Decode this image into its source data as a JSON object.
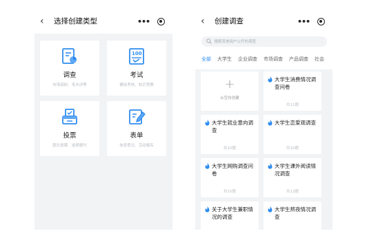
{
  "left": {
    "nav": {
      "back_icon": "chevron-left-icon",
      "title": "选择创建类型",
      "more_icon": "•••",
      "target_icon": "target-icon"
    },
    "types": [
      {
        "label": "调查",
        "sub": "市场调研、毛木评等",
        "icon": "survey-icon"
      },
      {
        "label": "考试",
        "sub": "模拟考核、知识竞赛",
        "icon": "exam-icon"
      },
      {
        "label": "投票",
        "sub": "图文投票、选择报刊",
        "icon": "vote-icon"
      },
      {
        "label": "表单",
        "sub": "信息登记、活动报名",
        "icon": "form-icon"
      }
    ]
  },
  "right": {
    "nav": {
      "back_icon": "chevron-left-icon",
      "title": "创建调查",
      "more_icon": "•••",
      "target_icon": "target-icon"
    },
    "search": {
      "placeholder": "搜索其他用户公开的调查"
    },
    "tabs": [
      "全部",
      "大学生",
      "企业调查",
      "市场调查",
      "产品调查",
      "社会"
    ],
    "active_tab": 0,
    "accent": "#2d8cf0",
    "blank": {
      "label": "从空白创建"
    },
    "templates": [
      {
        "name": "大学生消费情况调查问卷",
        "count": "共11题"
      },
      {
        "name": "大学生就业意向调查",
        "count": "共10题"
      },
      {
        "name": "大学生恋爱观调查",
        "count": "共10题"
      },
      {
        "name": "大学生网购调查问卷",
        "count": "共15题"
      },
      {
        "name": "大学生课外阅读情况调查",
        "count": "共13题"
      },
      {
        "name": "关于大学生兼职情况的调查",
        "count": ""
      },
      {
        "name": "大学生熬夜情况调查",
        "count": ""
      }
    ]
  }
}
